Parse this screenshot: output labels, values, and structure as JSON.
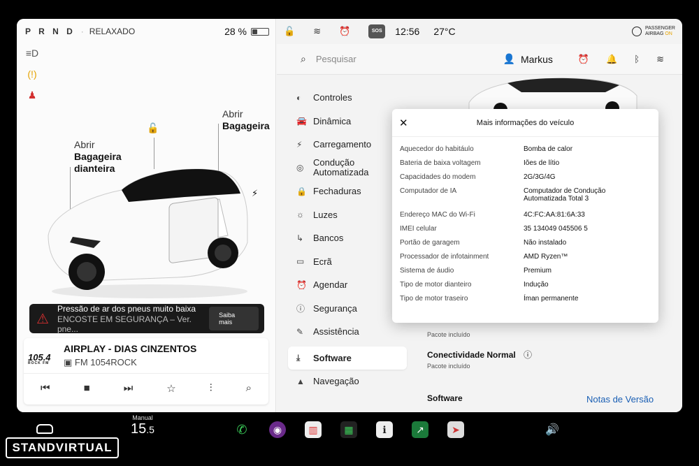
{
  "left": {
    "gear": "P R N D",
    "drive_mode": "RELAXADO",
    "battery_percent": "28 %",
    "battery_level": 0.28,
    "callout_front_top": "Abrir",
    "callout_front_bottom": "Bagageira dianteira",
    "callout_rear_top": "Abrir",
    "callout_rear_bottom": "Bagageira",
    "alert": {
      "title": "Pressão de ar dos pneus muito baixa",
      "subtitle": "ENCOSTE EM SEGURANÇA – Ver. pne...",
      "button": "Saiba mais"
    },
    "media": {
      "logo_main": "105.4",
      "logo_sub": "ROCK FM",
      "title": "AIRPLAY - DIAS CINZENTOS",
      "station": "FM 1054ROCK"
    }
  },
  "status": {
    "time": "12:56",
    "temperature": "27°C",
    "sos": "SOS",
    "airbag_line1": "PASSENGER",
    "airbag_line2": "AIRBAG",
    "airbag_state": "ON"
  },
  "search": {
    "placeholder": "Pesquisar",
    "user": "Markus"
  },
  "menu": [
    {
      "label": "Controles",
      "icon": "toggle-icon"
    },
    {
      "label": "Dinâmica",
      "icon": "car-icon"
    },
    {
      "label": "Carregamento",
      "icon": "bolt-icon"
    },
    {
      "label": "Condução Automatizada",
      "icon": "steering-wheel-icon"
    },
    {
      "label": "Fechaduras",
      "icon": "lock-icon"
    },
    {
      "label": "Luzes",
      "icon": "sun-icon"
    },
    {
      "label": "Bancos",
      "icon": "seat-icon"
    },
    {
      "label": "Ecrã",
      "icon": "screen-icon"
    },
    {
      "label": "Agendar",
      "icon": "alarm-icon"
    },
    {
      "label": "Segurança",
      "icon": "info-icon"
    },
    {
      "label": "Assistência",
      "icon": "wrench-icon"
    },
    {
      "label": "Software",
      "icon": "download-icon"
    },
    {
      "label": "Navegação",
      "icon": "navigation-icon"
    }
  ],
  "content": {
    "package1": "Pacote incluído",
    "connectivity": "Conectividade Normal",
    "package2": "Pacote incluído",
    "software_label": "Software",
    "release_notes": "Notas de Versão"
  },
  "modal": {
    "title": "Mais informações do veículo",
    "rows": [
      {
        "k": "Aquecedor do habitáulo",
        "v": "Bomba de calor"
      },
      {
        "k": "Bateria de baixa voltagem",
        "v": "Iões de lítio"
      },
      {
        "k": "Capacidades do modem",
        "v": "2G/3G/4G"
      },
      {
        "k": "Computador de IA",
        "v": "Computador de Condução Automatizada Total 3"
      },
      {
        "k": "Endereço MAC do Wi-Fi",
        "v": "4C:FC:AA:81:6A:33"
      },
      {
        "k": "IMEI celular",
        "v": "35 134049 045506 5"
      },
      {
        "k": "Portão de garagem",
        "v": "Não instalado"
      },
      {
        "k": "Processador de infotainment",
        "v": "AMD Ryzen™"
      },
      {
        "k": "Sistema de áudio",
        "v": "Premium"
      },
      {
        "k": "Tipo de motor dianteiro",
        "v": "Indução"
      },
      {
        "k": "Tipo de motor traseiro",
        "v": "Íman permanente"
      }
    ]
  },
  "dock": {
    "speed_label": "Manual",
    "speed_value": "15",
    "speed_decimal": ".5",
    "watermark": "STANDVIRTUAL"
  },
  "colors": {
    "accent_link": "#1a5fb4",
    "warning": "#e6a300",
    "alert_red": "#d32f2f"
  }
}
